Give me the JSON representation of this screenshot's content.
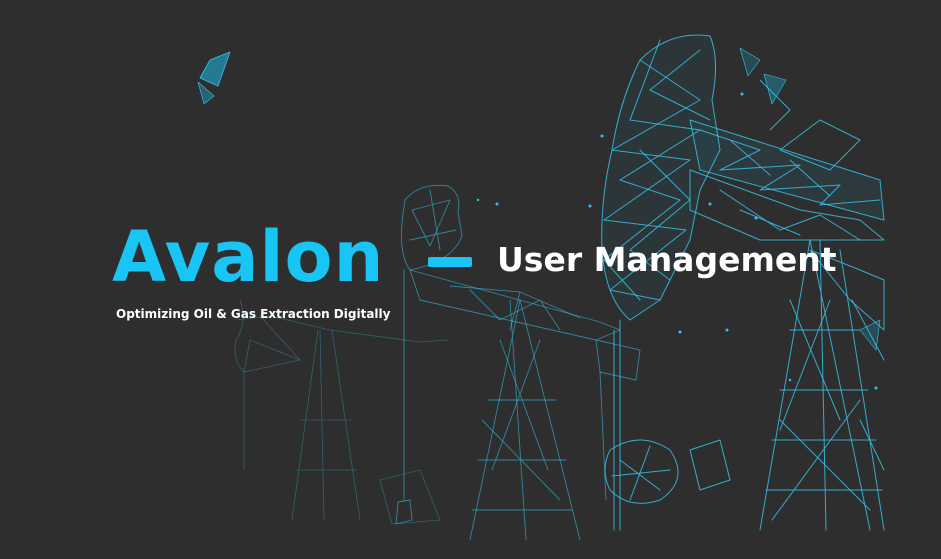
{
  "hero": {
    "brand": "Avalon",
    "subtitle": "User Management",
    "tagline": "Optimizing Oil & Gas Extraction Digitally"
  },
  "background_image": {
    "icon": "oil-pumpjack-wireframe-illustration"
  },
  "colors": {
    "background": "#2e2e2e",
    "accent": "#19c5f5",
    "wire": "#36c2e8",
    "text": "#ffffff"
  }
}
